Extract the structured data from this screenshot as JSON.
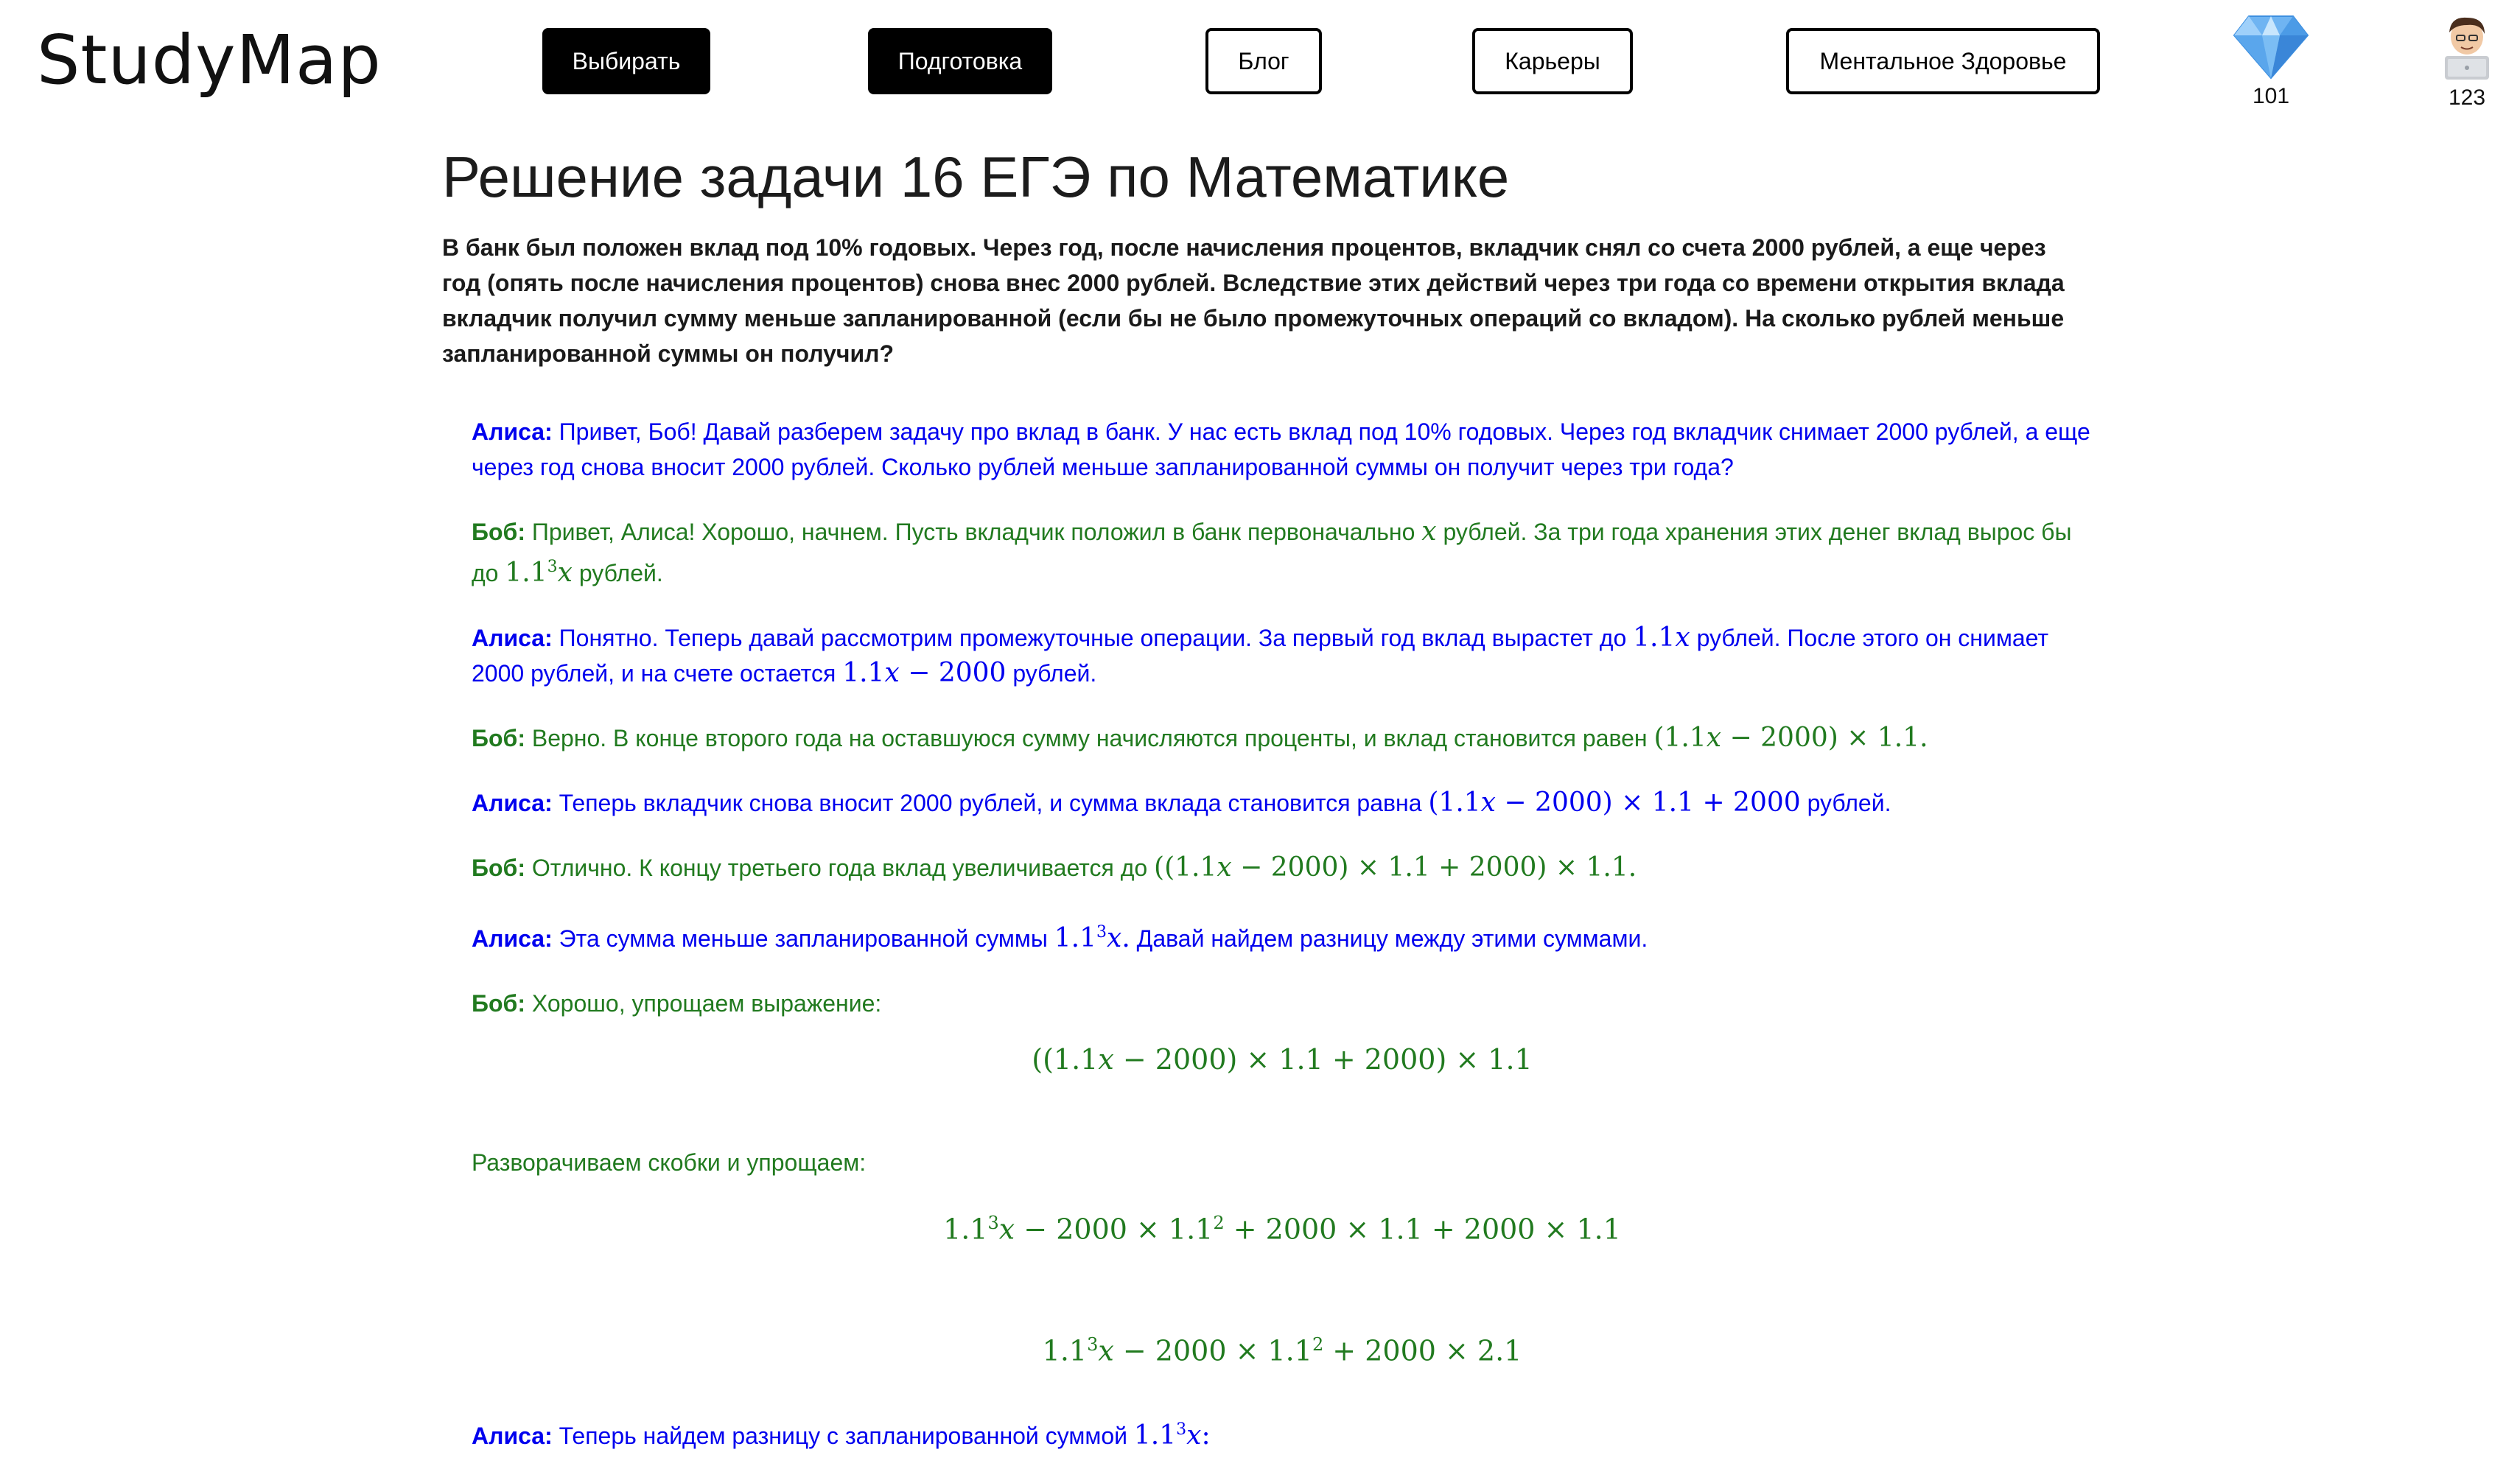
{
  "header": {
    "logo": "StudyMap",
    "nav": [
      {
        "label": "Выбирать",
        "style": "dark"
      },
      {
        "label": "Подготовка",
        "style": "dark"
      },
      {
        "label": "Блог",
        "style": "light"
      },
      {
        "label": "Карьеры",
        "style": "light"
      },
      {
        "label": "Ментальное Здоровье",
        "style": "light"
      }
    ],
    "gems": {
      "icon": "diamond-icon",
      "count": "101"
    },
    "profile": {
      "icon": "avatar-icon",
      "count": "123"
    }
  },
  "main": {
    "title": "Решение задачи 16 ЕГЭ по Математике",
    "problem": "В банк был положен вклад под 10% годовых. Через год, после начисления процентов, вкладчик снял со счета 2000 рублей, а еще через год (опять после начисления процентов) снова внес 2000 рублей. Вследствие этих действий через три года со времени открытия вклада вкладчик получил сумму меньше запланированной (если бы не было промежуточных операций со вкладом). На сколько рублей меньше запланированной суммы он получил?",
    "alice_name": "Алиса:",
    "bob_name": "Боб:",
    "messages": {
      "m1": "Привет, Боб! Давай разберем задачу про вклад в банк. У нас есть вклад под 10% годовых. Через год вкладчик снимает 2000 рублей, а еще через год снова вносит 2000 рублей. Сколько рублей меньше запланированной суммы он получит через три года?",
      "m2_a": "Привет, Алиса! Хорошо, начнем. Пусть вкладчик положил в банк первоначально",
      "m2_b": "рублей. За три года хранения этих денег вклад вырос бы до",
      "m2_c": "рублей.",
      "m3_a": "Понятно. Теперь давай рассмотрим промежуточные операции. За первый год вклад вырастет до",
      "m3_b": "рублей. После этого он снимает 2000 рублей, и на счете остается",
      "m3_c": "рублей.",
      "m4_a": "Верно. В конце второго года на оставшуюся сумму начисляются проценты, и вклад становится равен",
      "m5_a": "Теперь вкладчик снова вносит 2000 рублей, и сумма вклада становится равна",
      "m5_b": "рублей.",
      "m6_a": "Отлично. К концу третьего года вклад увеличивается до",
      "m7_a": "Эта сумма меньше запланированной суммы",
      "m7_b": "Давай найдем разницу между этими суммами.",
      "m8_a": "Хорошо, упрощаем выражение:",
      "m8_b": "Разворачиваем скобки и упрощаем:",
      "m9_a": "Теперь найдем разницу с запланированной суммой"
    }
  }
}
